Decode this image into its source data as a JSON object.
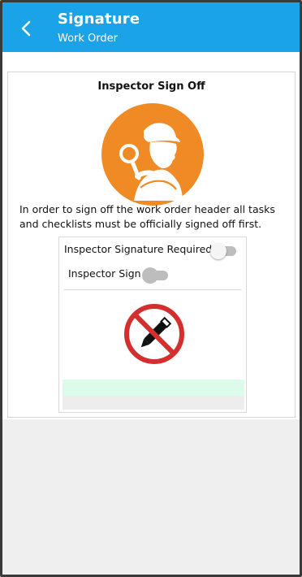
{
  "header": {
    "title": "Signature",
    "subtitle": "Work Order",
    "background_color": "#1aa3e8"
  },
  "card": {
    "title": "Inspector Sign Off",
    "icon": "inspector-detective-icon",
    "icon_color": "#f08a24",
    "message": "In order to sign off the work order header all tasks and checklists must be officially signed off first."
  },
  "signature_panel": {
    "required_label": "Inspector Signature Required",
    "required_toggle_on": false,
    "sign_label": "Inspector Sign",
    "sign_toggle_on": false,
    "sign_toggle_disabled": true,
    "status_icon": "no-edit-icon",
    "status_icon_color": "#d32f2f",
    "input_area_color": "#dcfbea"
  }
}
